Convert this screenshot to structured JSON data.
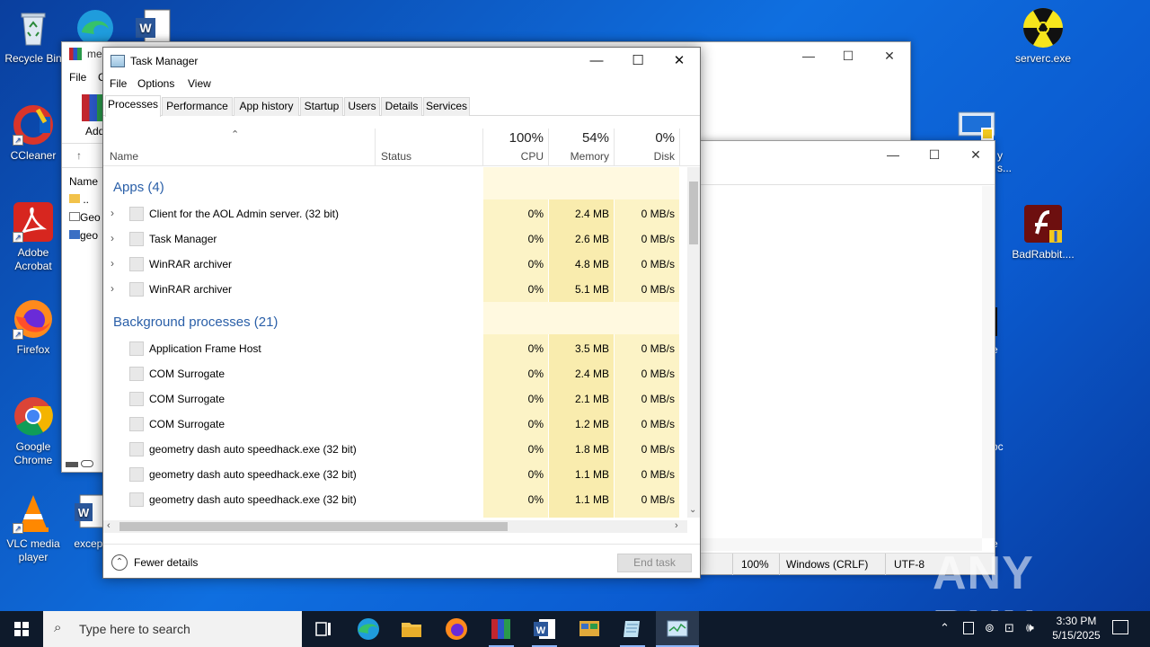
{
  "desktop": {
    "icons_left": [
      {
        "label": "Recycle Bin",
        "icon": "recycle-bin-icon"
      },
      {
        "label": "CCleaner",
        "icon": "ccleaner-icon"
      },
      {
        "label": "Adobe Acrobat",
        "icon": "acrobat-icon"
      },
      {
        "label": "Firefox",
        "icon": "firefox-icon"
      },
      {
        "label": "Google Chrome",
        "icon": "chrome-icon"
      },
      {
        "label": "VLC media player",
        "icon": "vlc-icon"
      }
    ],
    "icon_exception_label": "except",
    "icons_right": [
      {
        "label": "serverc.exe",
        "icon": "radioactive-icon"
      },
      {
        "label": "BadRabbit....",
        "icon": "flash-installer-icon"
      }
    ],
    "partial_right_text": [
      "y",
      "s...",
      "e",
      "oc",
      "e"
    ]
  },
  "explorer_window": {
    "title": "me",
    "menu": [
      "File",
      "C"
    ],
    "column_name": "Name",
    "files": [
      "..",
      "Geo",
      "geo"
    ],
    "ribbon_label": "Add"
  },
  "notepad_window": {
    "status": [
      "100%",
      "Windows (CRLF)",
      "UTF-8"
    ]
  },
  "task_manager": {
    "title": "Task Manager",
    "menu": [
      "File",
      "Options",
      "View"
    ],
    "tabs": [
      "Processes",
      "Performance",
      "App history",
      "Startup",
      "Users",
      "Details",
      "Services"
    ],
    "active_tab": "Processes",
    "columns": {
      "name": "Name",
      "status": "Status",
      "cpu_pct": "100%",
      "cpu_label": "CPU",
      "mem_pct": "54%",
      "mem_label": "Memory",
      "disk_pct": "0%",
      "disk_label": "Disk"
    },
    "groups": [
      {
        "title": "Apps (4)",
        "rows": [
          {
            "name": "Client for the AOL Admin server. (32 bit)",
            "cpu": "0%",
            "mem": "2.4 MB",
            "disk": "0 MB/s",
            "expandable": true
          },
          {
            "name": "Task Manager",
            "cpu": "0%",
            "mem": "2.6 MB",
            "disk": "0 MB/s",
            "expandable": true
          },
          {
            "name": "WinRAR archiver",
            "cpu": "0%",
            "mem": "4.8 MB",
            "disk": "0 MB/s",
            "expandable": true
          },
          {
            "name": "WinRAR archiver",
            "cpu": "0%",
            "mem": "5.1 MB",
            "disk": "0 MB/s",
            "expandable": true
          }
        ]
      },
      {
        "title": "Background processes (21)",
        "rows": [
          {
            "name": "Application Frame Host",
            "cpu": "0%",
            "mem": "3.5 MB",
            "disk": "0 MB/s",
            "expandable": false
          },
          {
            "name": "COM Surrogate",
            "cpu": "0%",
            "mem": "2.4 MB",
            "disk": "0 MB/s",
            "expandable": false
          },
          {
            "name": "COM Surrogate",
            "cpu": "0%",
            "mem": "2.1 MB",
            "disk": "0 MB/s",
            "expandable": false
          },
          {
            "name": "COM Surrogate",
            "cpu": "0%",
            "mem": "1.2 MB",
            "disk": "0 MB/s",
            "expandable": false
          },
          {
            "name": "geometry dash auto speedhack.exe (32 bit)",
            "cpu": "0%",
            "mem": "1.8 MB",
            "disk": "0 MB/s",
            "expandable": false
          },
          {
            "name": "geometry dash auto speedhack.exe (32 bit)",
            "cpu": "0%",
            "mem": "1.1 MB",
            "disk": "0 MB/s",
            "expandable": false
          },
          {
            "name": "geometry dash auto speedhack.exe (32 bit)",
            "cpu": "0%",
            "mem": "1.1 MB",
            "disk": "0 MB/s",
            "expandable": false
          }
        ]
      }
    ],
    "fewer_details": "Fewer details",
    "end_task": "End task"
  },
  "taskbar": {
    "search_placeholder": "Type here to search",
    "pinned": [
      "task-view-icon",
      "edge-icon",
      "file-explorer-icon",
      "firefox-icon",
      "winrar-icon",
      "word-icon",
      "control-panel-icon",
      "notepad-icon",
      "task-manager-icon"
    ],
    "time": "3:30 PM",
    "date": "5/15/2025"
  },
  "watermark": "ANY RUN"
}
